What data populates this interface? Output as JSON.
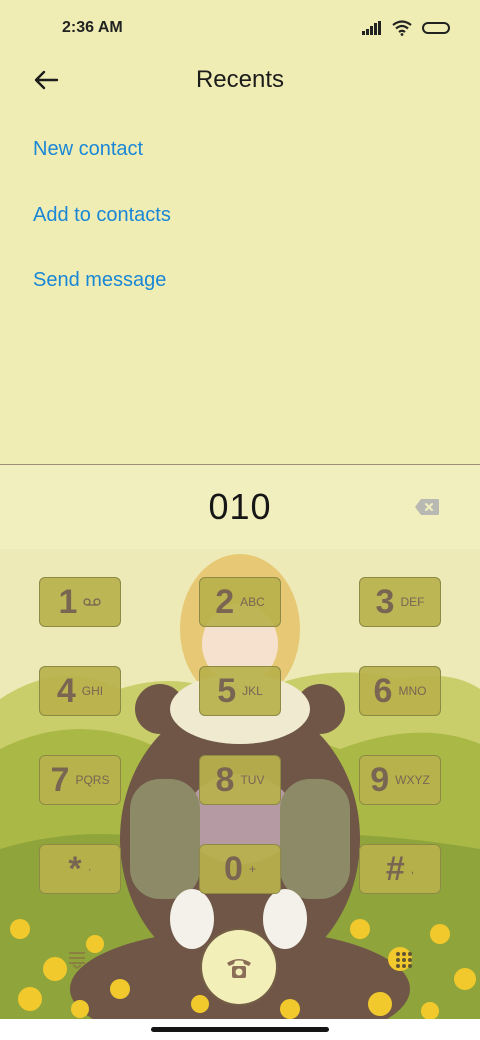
{
  "status_bar": {
    "time": "2:36 AM"
  },
  "header": {
    "title": "Recents"
  },
  "actions": {
    "new_contact": "New contact",
    "add_to_contacts": "Add to contacts",
    "send_message": "Send message"
  },
  "dialer": {
    "number": "010",
    "keys": [
      {
        "digit": "1",
        "letters": "voicemail-icon"
      },
      {
        "digit": "2",
        "letters": "ABC"
      },
      {
        "digit": "3",
        "letters": "DEF"
      },
      {
        "digit": "4",
        "letters": "GHI"
      },
      {
        "digit": "5",
        "letters": "JKL"
      },
      {
        "digit": "6",
        "letters": "MNO"
      },
      {
        "digit": "7",
        "letters": "PQRS"
      },
      {
        "digit": "8",
        "letters": "TUV"
      },
      {
        "digit": "9",
        "letters": "WXYZ"
      },
      {
        "digit": "*",
        "letters": "·"
      },
      {
        "digit": "0",
        "letters": "+"
      },
      {
        "digit": "#",
        "letters": ","
      }
    ]
  },
  "colors": {
    "background": "#efedb4",
    "link": "#1a87d6",
    "key_fill": "#b8b14c",
    "key_text": "#7a6553"
  }
}
